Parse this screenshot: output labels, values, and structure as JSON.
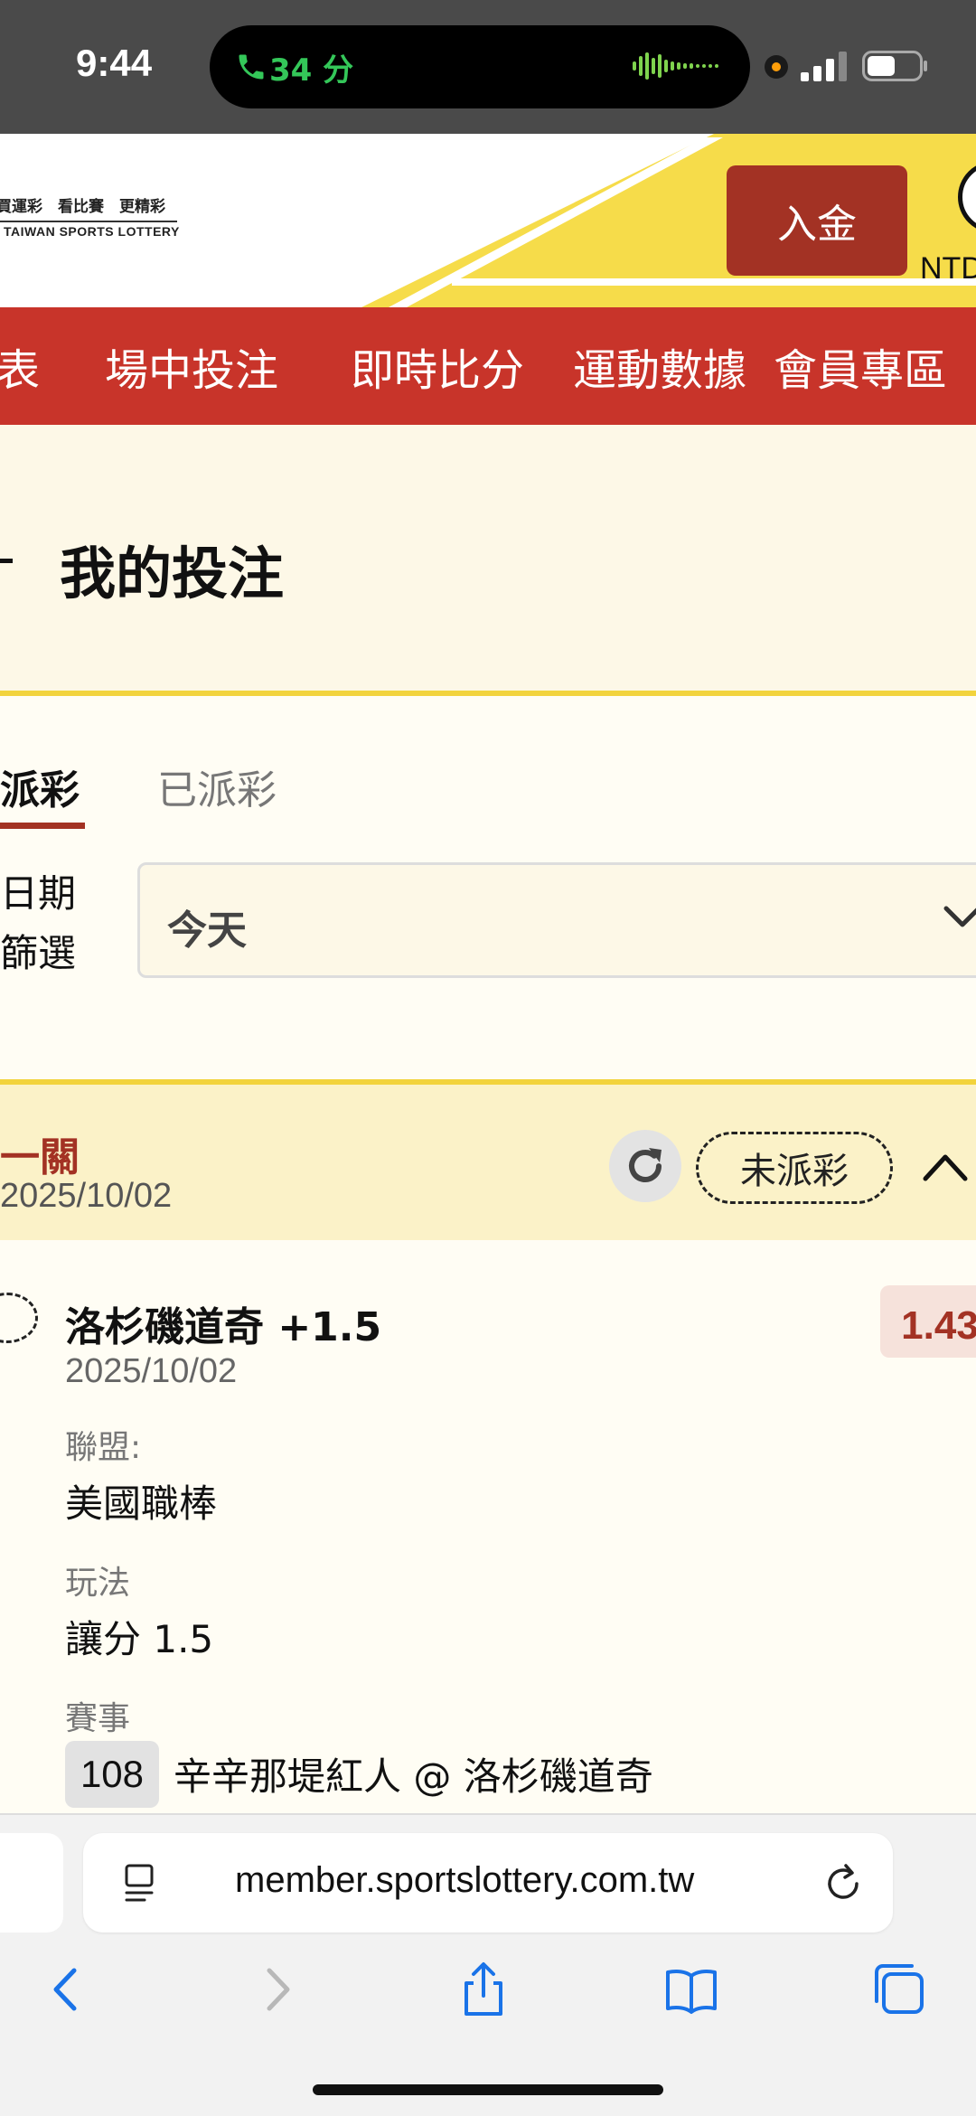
{
  "status_bar": {
    "time": "9:44",
    "call_duration": "34 分"
  },
  "header": {
    "logo_line1": "買運彩　看比賽　更精彩",
    "logo_line2": "TAIWAN SPORTS LOTTERY",
    "deposit_label": "入金",
    "currency": "NTD"
  },
  "nav": {
    "items": [
      "表",
      "場中投注",
      "即時比分",
      "運動數據",
      "會員專區"
    ]
  },
  "page": {
    "title": "我的投注"
  },
  "tabs": {
    "active": "派彩",
    "inactive": "已派彩"
  },
  "filter": {
    "label_line1": "日期",
    "label_line2": "篩選",
    "selected": "今天"
  },
  "bet": {
    "type": "一關",
    "date": "2025/10/02",
    "status": "未派彩",
    "selection": "洛杉磯道奇 +1.5",
    "selection_date": "2025/10/02",
    "odds": "1.43",
    "league_label": "聯盟:",
    "league_value": "美國職棒",
    "play_label": "玩法",
    "play_value": "讓分 1.5",
    "event_label": "賽事",
    "event_id": "108",
    "event_name": "辛辛那堤紅人 @ 洛杉磯道奇"
  },
  "browser": {
    "url": "member.sportslottery.com.tw"
  },
  "colors": {
    "brand_red": "#c8342a",
    "dark_red": "#a33224",
    "accent_yellow": "#f2d33d",
    "call_green": "#34c759"
  }
}
